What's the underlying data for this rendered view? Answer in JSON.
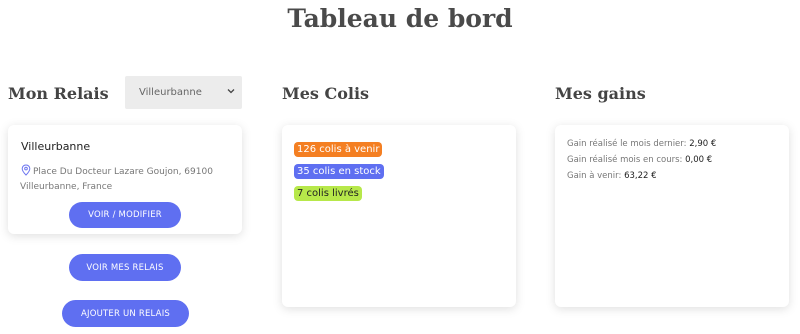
{
  "page_title": "Tableau de bord",
  "relais": {
    "heading": "Mon Relais",
    "select_value": "Villeurbanne",
    "card": {
      "name": "Villeurbanne",
      "address": "Place Du Docteur Lazare Goujon, 69100 Villeurbanne, France",
      "edit_button": "VOIR / MODIFIER"
    },
    "see_button": "VOIR MES RELAIS",
    "add_button": "AJOUTER UN RELAIS"
  },
  "colis": {
    "heading": "Mes Colis",
    "badges": [
      {
        "label": "126 colis à venir",
        "bg": "#f47f22",
        "fg": "#ffffff"
      },
      {
        "label": "35 colis en stock",
        "bg": "#5f6ff1",
        "fg": "#ffffff"
      },
      {
        "label": "7 colis livrés",
        "bg": "#b7e84a",
        "fg": "#222222"
      }
    ]
  },
  "gains": {
    "heading": "Mes gains",
    "lines": [
      {
        "label": "Gain réalisé le mois dernier: ",
        "value": "2,90 €"
      },
      {
        "label": "Gain réalisé mois en cours: ",
        "value": "0,00 €"
      },
      {
        "label": "Gain à venir: ",
        "value": "63,22 €"
      }
    ]
  },
  "colors": {
    "accent": "#5f6ff1",
    "orange": "#f47f22",
    "green": "#b7e84a"
  },
  "icons": [
    "location-pin-icon",
    "chevron-down-icon"
  ]
}
